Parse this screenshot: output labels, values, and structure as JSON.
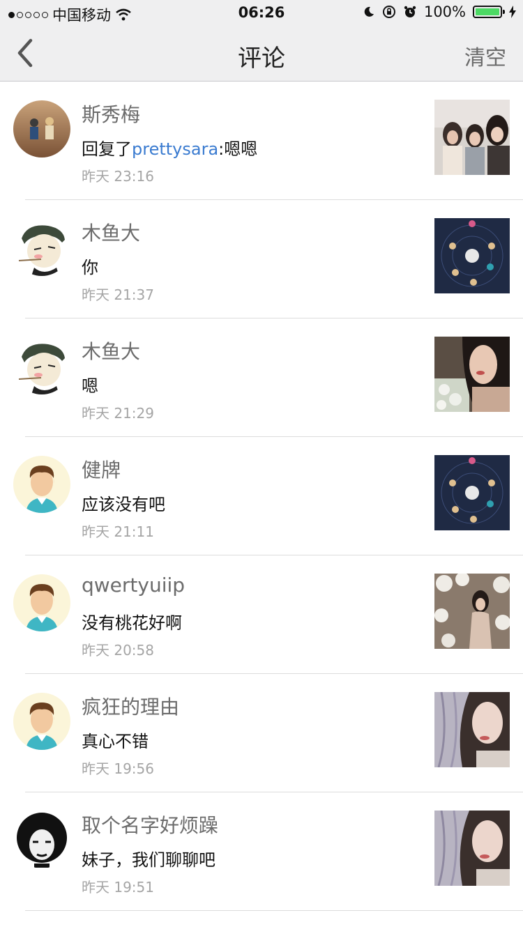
{
  "status_bar": {
    "carrier": "中国移动",
    "time": "06:26",
    "battery": "100%"
  },
  "nav": {
    "title": "评论",
    "clear_label": "清空"
  },
  "comments": [
    {
      "name": "斯秀梅",
      "prefix": "回复了",
      "mention": "prettysara",
      "text": ":嗯嗯",
      "time": "昨天 23:16"
    },
    {
      "name": "木鱼大",
      "prefix": "",
      "mention": "",
      "text": "你",
      "time": "昨天 21:37"
    },
    {
      "name": "木鱼大",
      "prefix": "",
      "mention": "",
      "text": "嗯",
      "time": "昨天 21:29"
    },
    {
      "name": "健牌",
      "prefix": "",
      "mention": "",
      "text": "应该没有吧",
      "time": "昨天 21:11"
    },
    {
      "name": "qwertyuiip",
      "prefix": "",
      "mention": "",
      "text": "没有桃花好啊",
      "time": "昨天 20:58"
    },
    {
      "name": "疯狂的理由",
      "prefix": "",
      "mention": "",
      "text": "真心不错",
      "time": "昨天 19:56"
    },
    {
      "name": "取个名字好烦躁",
      "prefix": "",
      "mention": "",
      "text": "妹子，我们聊聊吧",
      "time": "昨天 19:51"
    }
  ]
}
